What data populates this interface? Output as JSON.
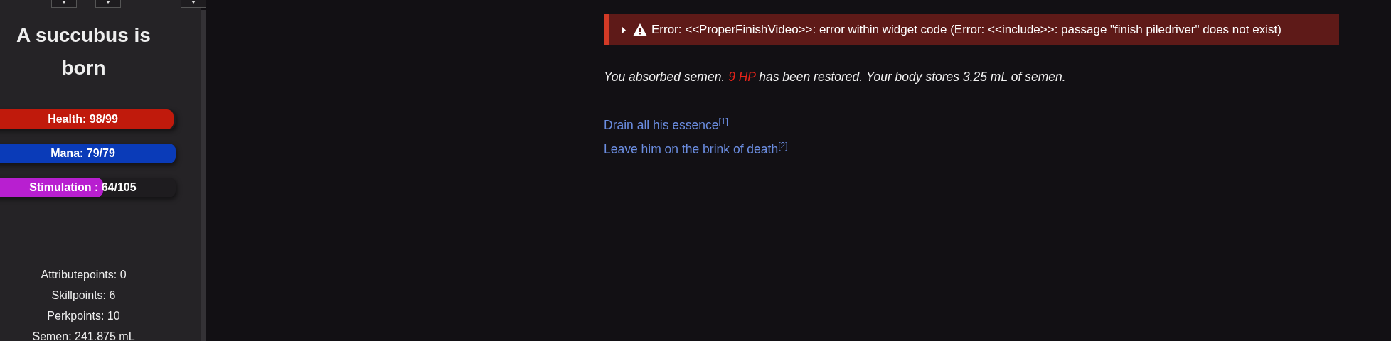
{
  "sidebar": {
    "top_buttons": [
      {
        "kind": "caret"
      },
      {
        "kind": "caret"
      },
      {
        "kind": "caret"
      }
    ],
    "title": "A succubus is born",
    "bars": [
      {
        "label": "Health: 98/99",
        "level": 0.99,
        "color": "#c01a0c"
      },
      {
        "label": "Mana: 79/79",
        "level": 1,
        "color": "#0a3bb8"
      },
      {
        "label": "Stimulation : 64/105",
        "level": 0.61,
        "color": "#b81fd0"
      }
    ],
    "stats": [
      "Attributepoints: 0",
      "Skillpoints: 6",
      "Perkpoints: 10",
      "Semen: 241.875 mL"
    ]
  },
  "main": {
    "error": {
      "expanded": false,
      "text": "Error: <<ProperFinishVideo>>: error within widget code (Error: <<include>>: passage \"finish piledriver\" does not exist)"
    },
    "message_parts": [
      {
        "text": "You absorbed semen. ",
        "kind": "plain"
      },
      {
        "text": "9 HP",
        "kind": "highlight"
      },
      {
        "text": " has been restored. Your body stores 3.25 mL of semen.",
        "kind": "plain"
      }
    ],
    "links": [
      {
        "text": "Drain all his essence",
        "note": "[1]"
      },
      {
        "text": "Leave him on the brink of death",
        "note": "[2]"
      }
    ]
  }
}
